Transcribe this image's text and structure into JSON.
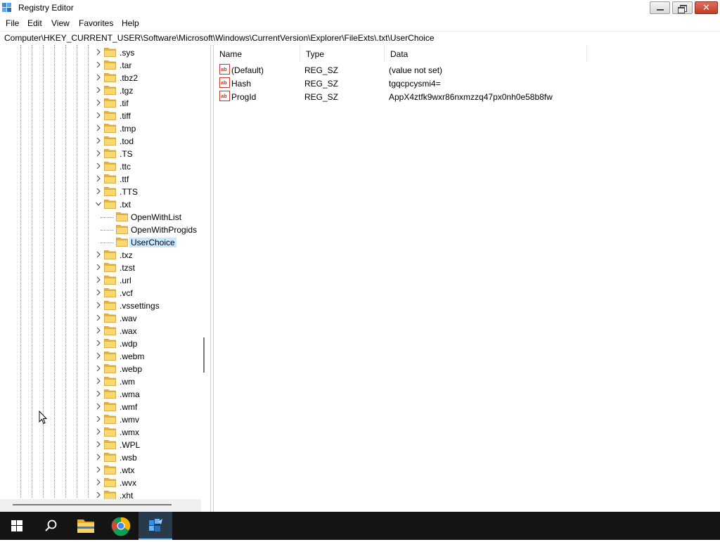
{
  "window": {
    "title": "Registry Editor",
    "close_glyph": "✕"
  },
  "menu": [
    "File",
    "Edit",
    "View",
    "Favorites",
    "Help"
  ],
  "address": "Computer\\HKEY_CURRENT_USER\\Software\\Microsoft\\Windows\\CurrentVersion\\Explorer\\FileExts\\.txt\\UserChoice",
  "tree": {
    "items": [
      {
        "label": ".sys",
        "level": 0,
        "expander": "collapsed",
        "selected": false
      },
      {
        "label": ".tar",
        "level": 0,
        "expander": "collapsed",
        "selected": false
      },
      {
        "label": ".tbz2",
        "level": 0,
        "expander": "collapsed",
        "selected": false
      },
      {
        "label": ".tgz",
        "level": 0,
        "expander": "collapsed",
        "selected": false
      },
      {
        "label": ".tif",
        "level": 0,
        "expander": "collapsed",
        "selected": false
      },
      {
        "label": ".tiff",
        "level": 0,
        "expander": "collapsed",
        "selected": false
      },
      {
        "label": ".tmp",
        "level": 0,
        "expander": "collapsed",
        "selected": false
      },
      {
        "label": ".tod",
        "level": 0,
        "expander": "collapsed",
        "selected": false
      },
      {
        "label": ".TS",
        "level": 0,
        "expander": "collapsed",
        "selected": false
      },
      {
        "label": ".ttc",
        "level": 0,
        "expander": "collapsed",
        "selected": false
      },
      {
        "label": ".ttf",
        "level": 0,
        "expander": "collapsed",
        "selected": false
      },
      {
        "label": ".TTS",
        "level": 0,
        "expander": "collapsed",
        "selected": false
      },
      {
        "label": ".txt",
        "level": 0,
        "expander": "expanded",
        "selected": false
      },
      {
        "label": "OpenWithList",
        "level": 1,
        "expander": "none",
        "selected": false
      },
      {
        "label": "OpenWithProgids",
        "level": 1,
        "expander": "none",
        "selected": false
      },
      {
        "label": "UserChoice",
        "level": 1,
        "expander": "none",
        "selected": true
      },
      {
        "label": ".txz",
        "level": 0,
        "expander": "collapsed",
        "selected": false
      },
      {
        "label": ".tzst",
        "level": 0,
        "expander": "collapsed",
        "selected": false
      },
      {
        "label": ".url",
        "level": 0,
        "expander": "collapsed",
        "selected": false
      },
      {
        "label": ".vcf",
        "level": 0,
        "expander": "collapsed",
        "selected": false
      },
      {
        "label": ".vssettings",
        "level": 0,
        "expander": "collapsed",
        "selected": false
      },
      {
        "label": ".wav",
        "level": 0,
        "expander": "collapsed",
        "selected": false
      },
      {
        "label": ".wax",
        "level": 0,
        "expander": "collapsed",
        "selected": false
      },
      {
        "label": ".wdp",
        "level": 0,
        "expander": "collapsed",
        "selected": false
      },
      {
        "label": ".webm",
        "level": 0,
        "expander": "collapsed",
        "selected": false
      },
      {
        "label": ".webp",
        "level": 0,
        "expander": "collapsed",
        "selected": false
      },
      {
        "label": ".wm",
        "level": 0,
        "expander": "collapsed",
        "selected": false
      },
      {
        "label": ".wma",
        "level": 0,
        "expander": "collapsed",
        "selected": false
      },
      {
        "label": ".wmf",
        "level": 0,
        "expander": "collapsed",
        "selected": false
      },
      {
        "label": ".wmv",
        "level": 0,
        "expander": "collapsed",
        "selected": false
      },
      {
        "label": ".wmx",
        "level": 0,
        "expander": "collapsed",
        "selected": false
      },
      {
        "label": ".WPL",
        "level": 0,
        "expander": "collapsed",
        "selected": false
      },
      {
        "label": ".wsb",
        "level": 0,
        "expander": "collapsed",
        "selected": false
      },
      {
        "label": ".wtx",
        "level": 0,
        "expander": "collapsed",
        "selected": false
      },
      {
        "label": ".wvx",
        "level": 0,
        "expander": "collapsed",
        "selected": false
      },
      {
        "label": ".xht",
        "level": 0,
        "expander": "collapsed",
        "selected": false
      }
    ]
  },
  "list": {
    "columns": [
      "Name",
      "Type",
      "Data"
    ],
    "rows": [
      {
        "name": "(Default)",
        "type": "REG_SZ",
        "data": "(value not set)",
        "icon": "string-value-icon"
      },
      {
        "name": "Hash",
        "type": "REG_SZ",
        "data": "tgqcpcysmi4=",
        "icon": "string-value-icon"
      },
      {
        "name": "ProgId",
        "type": "REG_SZ",
        "data": "AppX4ztfk9wxr86nxmzzq47px0nh0e58b8fw",
        "icon": "string-value-icon"
      }
    ]
  },
  "taskbar": {
    "items": [
      {
        "icon": "windows-start-icon",
        "active": false
      },
      {
        "icon": "search-icon",
        "active": false
      },
      {
        "icon": "file-explorer-icon",
        "active": false
      },
      {
        "icon": "chrome-icon",
        "active": false
      },
      {
        "icon": "registry-editor-icon",
        "active": true
      }
    ]
  },
  "colors": {
    "selection": "#cce8ff",
    "folder": "#f8d775",
    "taskbar": "#141414",
    "close_button": "#c23a26"
  }
}
